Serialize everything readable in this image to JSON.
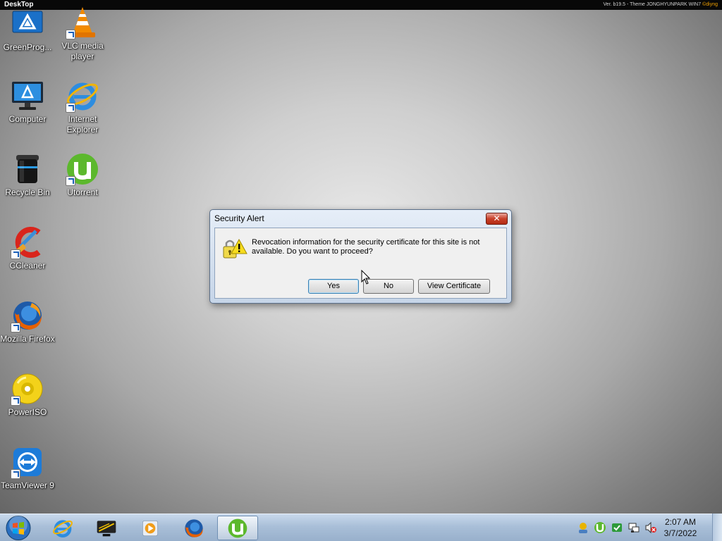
{
  "topbar": {
    "title": "DeskTop",
    "version_text": "Ver. b19.5 - Theme JONGHYUNPARK WIN7 ",
    "version_author": "©diyng"
  },
  "desktop_icons": [
    {
      "label": "GreenProg...",
      "icon": "greenprog-icon"
    },
    {
      "label": "VLC media player",
      "icon": "vlc-icon"
    },
    {
      "label": "Computer",
      "icon": "computer-icon"
    },
    {
      "label": "Internet Explorer",
      "icon": "internet-explorer-icon"
    },
    {
      "label": "Recycle Bin",
      "icon": "recycle-bin-icon"
    },
    {
      "label": "Utorrent",
      "icon": "utorrent-icon"
    },
    {
      "label": "CCleaner",
      "icon": "ccleaner-icon"
    },
    {
      "label": "Mozilla Firefox",
      "icon": "firefox-icon"
    },
    {
      "label": "PowerISO",
      "icon": "poweriso-icon"
    },
    {
      "label": "TeamViewer 9",
      "icon": "teamviewer-icon"
    }
  ],
  "dialog": {
    "title": "Security Alert",
    "close_label": "✕",
    "message_line1": "Revocation information for the security certificate for this site is not",
    "message_line2": "available. Do you want to proceed?",
    "buttons": {
      "yes": "Yes",
      "no": "No",
      "view_certificate": "View Certificate"
    },
    "icon": "warning-lock-icon"
  },
  "taskbar": {
    "pinned": [
      "internet-explorer-icon",
      "media-center-icon",
      "media-player-icon",
      "firefox-icon",
      "utorrent-icon"
    ],
    "active": "utorrent-icon",
    "tray_icons": [
      "user-tray-icon",
      "utorrent-tray-icon",
      "update-tray-icon",
      "network-tray-icon",
      "volume-muted-tray-icon"
    ],
    "clock_time": "2:07 AM",
    "clock_date": "3/7/2022"
  },
  "colors": {
    "desktop_center": "#e8e8e8",
    "desktop_edge": "#666666",
    "taskbar": "#a9bfd8",
    "close_button": "#c8412a"
  }
}
